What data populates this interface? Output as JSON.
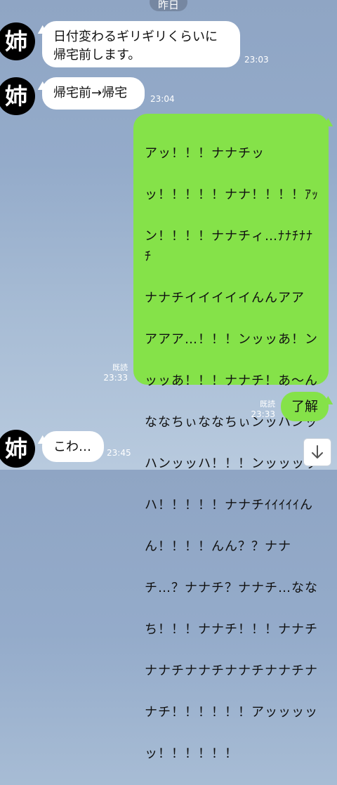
{
  "date_label": "昨日",
  "avatar_glyph": "姉",
  "messages": [
    {
      "side": "in",
      "text": "日付変わるギリギリくらいに\n帰宅前します。",
      "time": "23:03"
    },
    {
      "side": "in",
      "text": "帰宅前→帰宅",
      "time": "23:04"
    },
    {
      "side": "out",
      "read_label": "既読",
      "time": "23:33",
      "lines": [
        "アッ！！！ナナチッ",
        "ッ！！！！！ナナ！！！！ｱｯ",
        "ン！！！！ナナチィ…ﾅﾅﾁﾅﾅﾁ",
        "ナナチイイイイイんんアア",
        "アアア…！！！ンッッあ！ン",
        "ッッあ！！！ナナチ！あ～ん",
        "ななちぃななちぃンッハンッ",
        "ハンッッハ！！！ンッッッッ",
        "ハ！！！！！ナナチｲｲｲｲｲん",
        "ん！！！！んん？？ナナ",
        "チ…？ナナチ？ナナチ…なな",
        "ち！！！ナナチ！！！ナナチ",
        "ナナチナナチナナチナナチナ",
        "ナチ！！！！！！アッッッッ",
        "ッ！！！！！！"
      ]
    },
    {
      "side": "out",
      "read_label": "既読",
      "time": "23:33",
      "text": "了解"
    },
    {
      "side": "in",
      "text": "こわ…",
      "time": "23:45"
    }
  ],
  "scroll_button_icon": "arrow-down-icon",
  "colors": {
    "outgoing": "#85e249",
    "incoming": "#ffffff",
    "avatar_bg": "#000000"
  }
}
